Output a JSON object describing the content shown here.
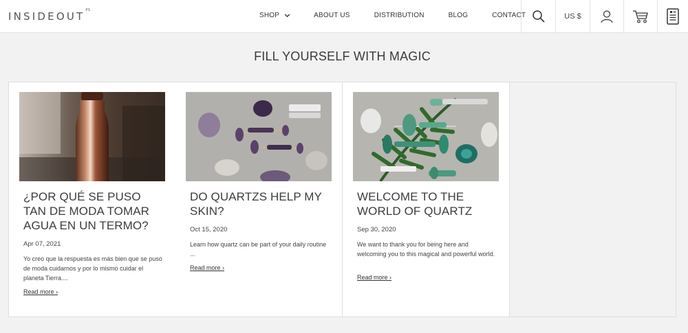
{
  "header": {
    "logo": "INSIDEOUT",
    "logo_superscript": "PS",
    "nav": [
      {
        "label": "SHOP"
      },
      {
        "label": "ABOUT US"
      },
      {
        "label": "DISTRIBUTION"
      },
      {
        "label": "BLOG"
      },
      {
        "label": "CONTACT"
      }
    ],
    "currency": "US $",
    "icons": [
      "search-icon",
      "user-icon",
      "cart-icon",
      "list-icon"
    ]
  },
  "main": {
    "headline": "FILL YOURSELF WITH MAGIC",
    "read_more": "Read more ›",
    "posts": [
      {
        "title": "¿POR QUÉ SE PUSO TAN DE MODA TOMAR AGUA EN UN TERMO?",
        "date": "Apr 07, 2021",
        "excerpt": "Yo creo que la respuesta es más bien que se puso de moda cuidarnos y por lo mismo cuidar el planeta Tierra....",
        "image": "copper-bottle-photo"
      },
      {
        "title": "DO QUARTZS HELP MY SKIN?",
        "date": "Oct 15, 2020",
        "excerpt": "Learn how quartz can be part of your daily routine ...",
        "image": "amethyst-rollers-photo"
      },
      {
        "title": "WELCOME TO THE WORLD OF QUARTZ",
        "date": "Sep 30, 2020",
        "excerpt": "We want to thank you for being here and welcoming you to this magical and powerful world.",
        "image": "jade-rollers-photo"
      }
    ]
  }
}
